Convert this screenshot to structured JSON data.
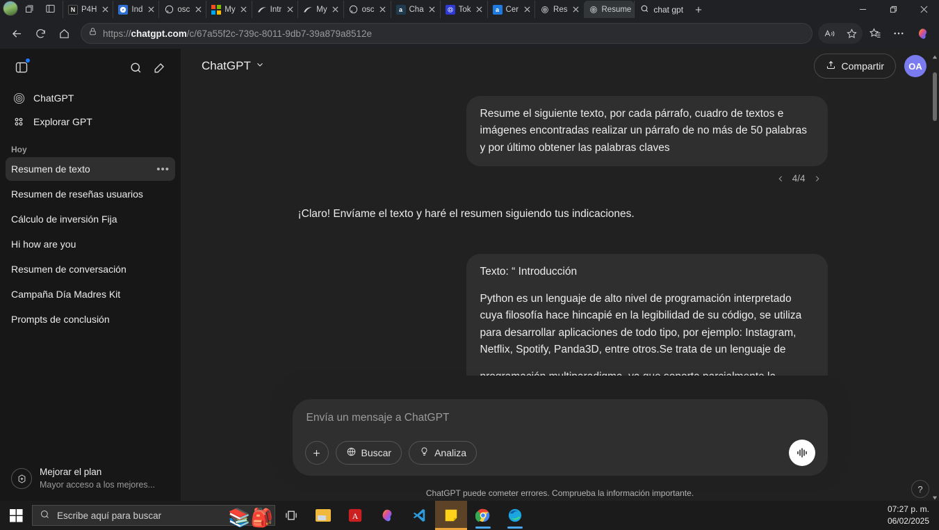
{
  "browser": {
    "tabs": [
      {
        "title": "P4H",
        "favicon": "news-icon",
        "active": false
      },
      {
        "title": "Índ",
        "favicon": "compass-icon",
        "active": false
      },
      {
        "title": "osc",
        "favicon": "github-icon",
        "active": false
      },
      {
        "title": "My",
        "favicon": "microsoft-icon",
        "active": false
      },
      {
        "title": "Intr",
        "favicon": "arc-icon",
        "active": false
      },
      {
        "title": "My",
        "favicon": "arc-icon",
        "active": false
      },
      {
        "title": "osc",
        "favicon": "github-icon",
        "active": false
      },
      {
        "title": "Cha",
        "favicon": "amazon-dark-icon",
        "active": false
      },
      {
        "title": "Tok",
        "favicon": "token-icon",
        "active": false
      },
      {
        "title": "Cer",
        "favicon": "amazon-blue-icon",
        "active": false
      },
      {
        "title": "Res",
        "favicon": "openai-icon",
        "active": false
      },
      {
        "title": "Resume",
        "favicon": "openai-icon",
        "active": true
      }
    ],
    "new_tab_search_text": "chat gpt",
    "url": {
      "scheme": "https://",
      "domain": "chatgpt.com",
      "path": "/c/67a55f2c-739c-8011-9db7-39a879a8512e"
    },
    "window_controls": {
      "minimize": "minimize-icon",
      "maximize": "restore-icon",
      "close": "close-icon"
    }
  },
  "sidebar": {
    "nav": [
      {
        "label": "ChatGPT",
        "icon": "openai-logo-icon"
      },
      {
        "label": "Explorar GPT",
        "icon": "grid-dots-icon"
      }
    ],
    "section_label": "Hoy",
    "chats": [
      {
        "label": "Resumen de texto",
        "active": true
      },
      {
        "label": "Resumen de reseñas usuarios",
        "active": false
      },
      {
        "label": "Cálculo de inversión Fija",
        "active": false
      },
      {
        "label": "Hi how are you",
        "active": false
      },
      {
        "label": "Resumen de conversación",
        "active": false
      },
      {
        "label": "Campaña Día Madres Kit",
        "active": false
      },
      {
        "label": "Prompts de conclusión",
        "active": false
      }
    ],
    "upgrade": {
      "title": "Mejorar el plan",
      "subtitle": "Mayor acceso a los mejores..."
    }
  },
  "header": {
    "model": "ChatGPT",
    "share_label": "Compartir",
    "avatar_initials": "OA"
  },
  "thread": {
    "user_message_1": "Resume el siguiente texto, por cada párrafo, cuadro de textos e imágenes encontradas realizar un párrafo de no más de 50 palabras y por último obtener las palabras claves",
    "pager": "4/4",
    "assistant_message_1": "¡Claro! Envíame el texto y haré el resumen siguiendo tus indicaciones.",
    "user_message_2_title": "Texto: “ Introducción",
    "user_message_2_body": "Python es un lenguaje de alto nivel de programación interpretado cuya filosofía hace hincapié en la legibilidad de su código, se utiliza para desarrollar aplicaciones de todo tipo, por ejemplo: Instagram, Netflix, Spotify, Panda3D, entre otros.Se trata de un lenguaje de",
    "user_message_2_clipped": "programación multiparadigma, ya que soporta parcialmente la"
  },
  "composer": {
    "placeholder": "Envía un mensaje a ChatGPT",
    "attach_label": "+",
    "chips": [
      {
        "label": "Buscar",
        "icon": "globe-icon"
      },
      {
        "label": "Analiza",
        "icon": "lightbulb-icon"
      }
    ],
    "voice_icon": "voice-waveform-icon"
  },
  "footer": {
    "disclaimer": "ChatGPT puede cometer errores. Comprueba la información importante.",
    "help": "?"
  },
  "taskbar": {
    "search_placeholder": "Escribe aquí para buscar",
    "apps": [
      {
        "name": "task-view-icon"
      },
      {
        "name": "file-explorer-icon"
      },
      {
        "name": "adobe-acrobat-icon"
      },
      {
        "name": "microsoft-copilot-icon"
      },
      {
        "name": "visual-studio-code-icon"
      },
      {
        "name": "sticky-notes-icon"
      },
      {
        "name": "google-chrome-icon"
      },
      {
        "name": "microsoft-edge-icon"
      }
    ],
    "clock_time": "07:27 p. m.",
    "clock_date": "06/02/2025"
  },
  "colors": {
    "accent_blue": "#1a7aff",
    "avatar": "#7b7bf0",
    "sidebar_bg": "#171717",
    "main_bg": "#212121",
    "bubble_bg": "#2f2f2f"
  }
}
